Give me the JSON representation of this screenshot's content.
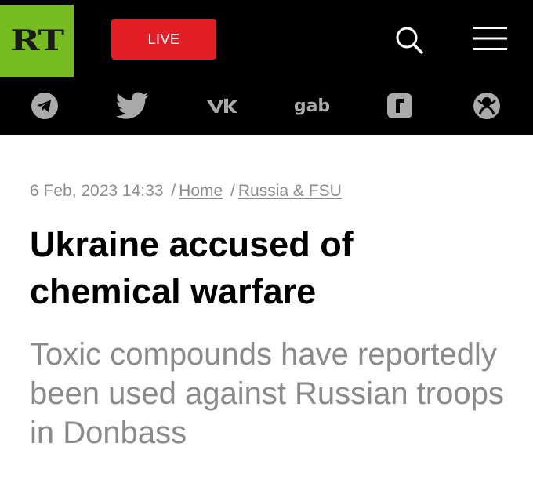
{
  "header": {
    "logo_text": "RT",
    "live_label": "LIVE",
    "colors": {
      "background": "#000000",
      "logo_bg": "#76bc21",
      "live_bg": "#e11d26"
    },
    "icons": [
      "search-icon",
      "menu-icon"
    ]
  },
  "social": {
    "items": [
      {
        "name": "telegram",
        "icon": "telegram-icon"
      },
      {
        "name": "twitter",
        "icon": "twitter-icon"
      },
      {
        "name": "vk",
        "icon": "vk-icon"
      },
      {
        "name": "gab",
        "label": "gab"
      },
      {
        "name": "rumble",
        "icon": "rumble-icon"
      },
      {
        "name": "odysee",
        "icon": "odysee-icon"
      }
    ]
  },
  "article": {
    "timestamp": "6 Feb, 2023 14:33",
    "separator": "/",
    "breadcrumbs": [
      "Home",
      "Russia & FSU"
    ],
    "headline": "Ukraine accused of chemical warfare",
    "subheadline": "Toxic compounds have reportedly been used against Russian troops in Donbass"
  }
}
